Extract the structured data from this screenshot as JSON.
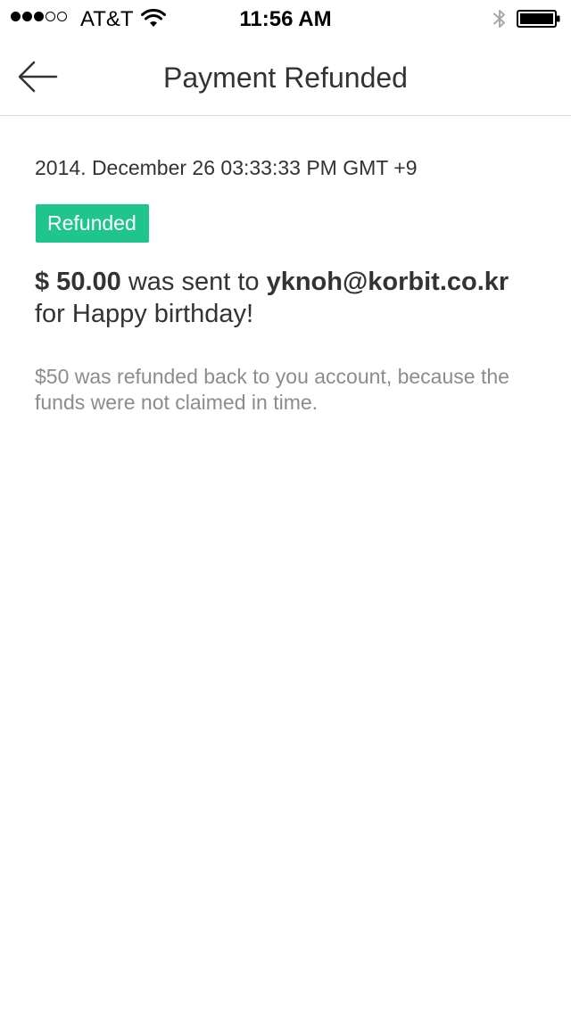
{
  "status_bar": {
    "carrier": "AT&T",
    "time": "11:56 AM",
    "signal_bars_filled": 3,
    "signal_bars_total": 5,
    "icons": [
      "wifi-icon",
      "bluetooth-icon",
      "battery-icon"
    ]
  },
  "nav": {
    "title": "Payment Refunded",
    "back_icon": "arrow-left-icon"
  },
  "payment": {
    "date": "2014. December 26 03:33:33 PM GMT +9",
    "status_badge": "Refunded",
    "status_color": "#1fc58c",
    "amount": "$ 50.00",
    "sent_text": " was sent to ",
    "recipient": "yknoh@korbit.co.kr",
    "memo_prefix": "for ",
    "memo": "Happy birthday!",
    "refund_note": "$50 was refunded back to you account, because the funds were not claimed in time."
  }
}
